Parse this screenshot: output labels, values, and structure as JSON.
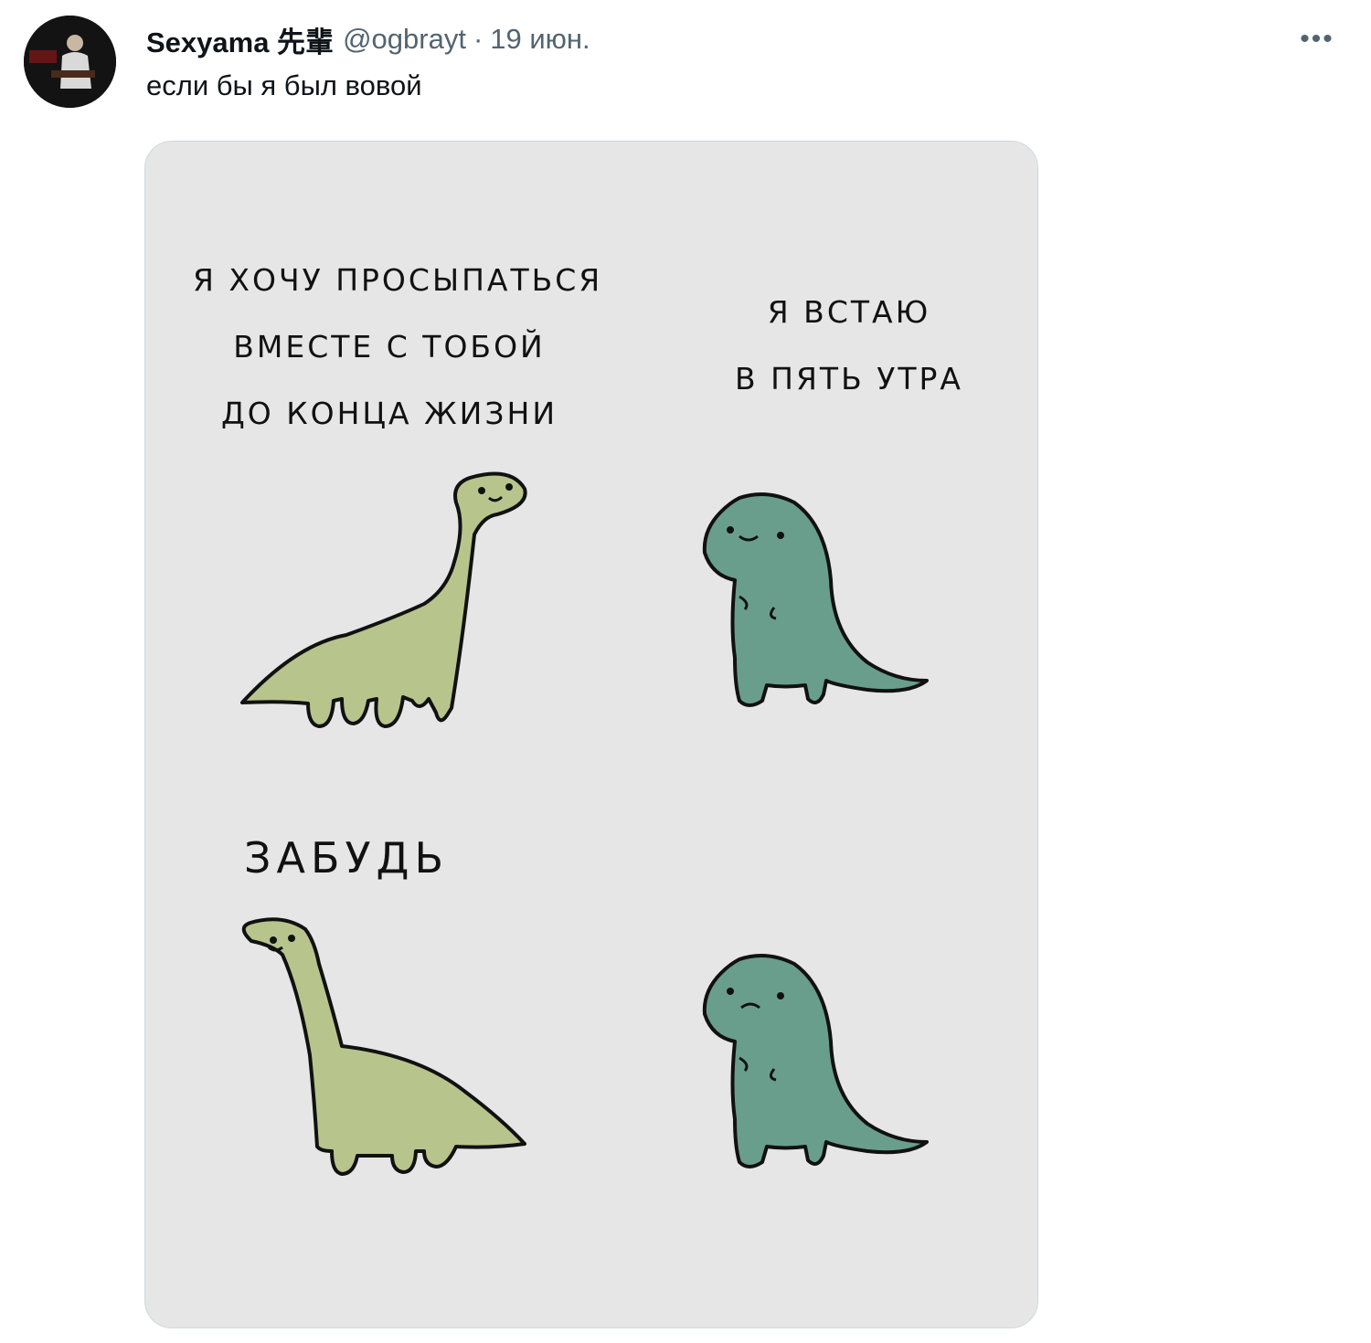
{
  "tweet": {
    "display_name": "Sexyama 先輩",
    "handle": "@ogbrayt",
    "separator": "·",
    "timestamp": "19 июн.",
    "more_label": "•••",
    "text": "если бы я был вовой"
  },
  "comic": {
    "panel1_lines": [
      "Я ХОЧУ ПРОСЫПАТЬСЯ",
      "ВМЕСТЕ С ТОБОЙ",
      "ДО КОНЦА ЖИЗНИ"
    ],
    "panel2_lines": [
      "Я ВСТАЮ",
      "В ПЯТЬ УТРА"
    ],
    "panel3_text": "ЗАБУДЬ"
  },
  "colors": {
    "brontosaurus": "#b7c58d",
    "trex": "#6a9e8c",
    "media_bg": "#e6e6e6"
  }
}
